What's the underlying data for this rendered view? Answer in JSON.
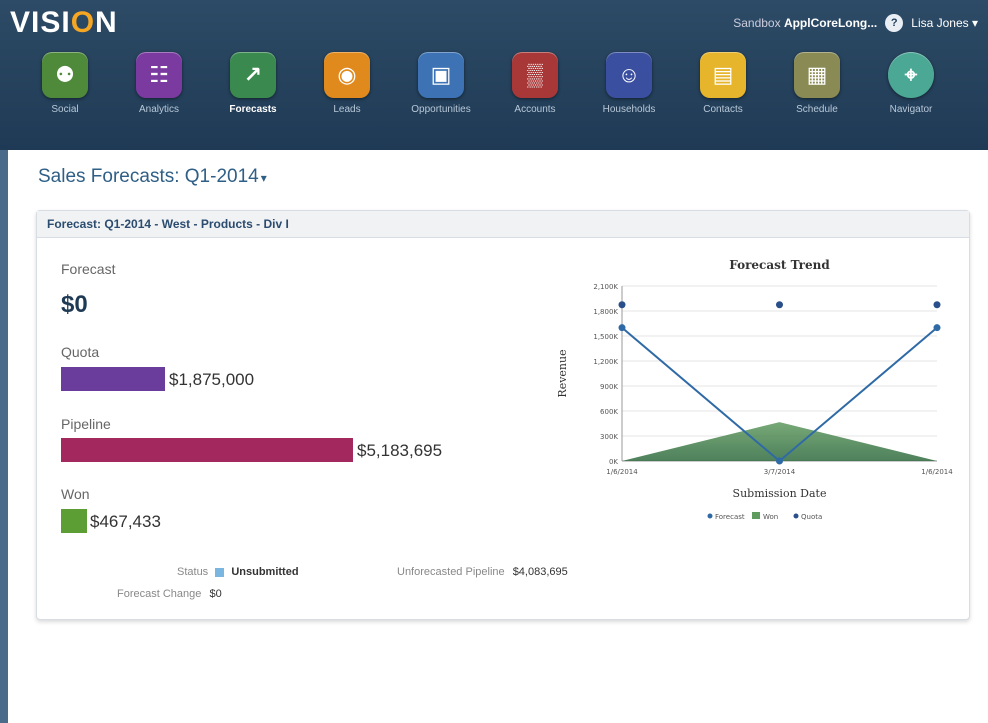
{
  "app": {
    "logo_prefix": "VISI",
    "logo_o": "O",
    "logo_suffix": "N",
    "sandbox_label": "Sandbox",
    "sandbox_name": "ApplCoreLong...",
    "help_glyph": "?",
    "user_menu": "Lisa Jones ▾"
  },
  "nav": {
    "items": [
      {
        "label": "Social",
        "icon": "social-icon",
        "color": "#4f8a3b",
        "glyph": "⚉"
      },
      {
        "label": "Analytics",
        "icon": "analytics-icon",
        "color": "#7b3aa0",
        "glyph": "☷"
      },
      {
        "label": "Forecasts",
        "icon": "forecasts-icon",
        "color": "#3a8a4f",
        "glyph": "↗"
      },
      {
        "label": "Leads",
        "icon": "leads-icon",
        "color": "#e08a1e",
        "glyph": "◉"
      },
      {
        "label": "Opportunities",
        "icon": "opportunities-icon",
        "color": "#3d73b5",
        "glyph": "▣"
      },
      {
        "label": "Accounts",
        "icon": "accounts-icon",
        "color": "#a83838",
        "glyph": "▒"
      },
      {
        "label": "Households",
        "icon": "households-icon",
        "color": "#3a4fa0",
        "glyph": "☺"
      },
      {
        "label": "Contacts",
        "icon": "contacts-icon",
        "color": "#e6b52b",
        "glyph": "▤"
      },
      {
        "label": "Schedule",
        "icon": "schedule-icon",
        "color": "#8a8a55",
        "glyph": "▦"
      },
      {
        "label": "Navigator",
        "icon": "navigator-icon",
        "color": "#4aa894",
        "glyph": "⌖"
      }
    ],
    "active": "Forecasts"
  },
  "page": {
    "title": "Sales Forecasts: Q1-2014",
    "title_caret": "▾"
  },
  "card": {
    "title": "Forecast: Q1-2014 - West - Products - Div I",
    "forecast_label": "Forecast",
    "forecast_value": "$0",
    "quota_label": "Quota",
    "quota_value": "$1,875,000",
    "quota_color": "#6a3c9b",
    "pipeline_label": "Pipeline",
    "pipeline_value": "$5,183,695",
    "pipeline_color": "#a3285e",
    "won_label": "Won",
    "won_value": "$467,433",
    "won_color": "#5c9e33",
    "status_label": "Status",
    "status_value": "Unsubmitted",
    "unforecasted_label": "Unforecasted Pipeline",
    "unforecasted_value": "$4,083,695",
    "change_label": "Forecast Change",
    "change_value": "$0"
  },
  "chart_data": {
    "type": "line",
    "title": "Forecast Trend",
    "xlabel": "Submission Date",
    "ylabel": "Revenue",
    "categories": [
      "1/6/2014",
      "3/7/2014",
      "1/6/2014"
    ],
    "ylim": [
      0,
      2100
    ],
    "yticks": [
      "0K",
      "300K",
      "600K",
      "900K",
      "1,200K",
      "1,500K",
      "1,800K",
      "2,100K"
    ],
    "series": [
      {
        "name": "Forecast",
        "type": "line",
        "color": "#2f6aa6",
        "values": [
          1600,
          0,
          1600
        ]
      },
      {
        "name": "Won",
        "type": "area",
        "color": "#5f9a5f",
        "values": [
          0,
          467,
          0
        ]
      },
      {
        "name": "Quota",
        "type": "scatter",
        "color": "#2a4f8a",
        "values": [
          1875,
          1875,
          1875
        ]
      }
    ],
    "legend_position": "bottom",
    "grid": true
  }
}
